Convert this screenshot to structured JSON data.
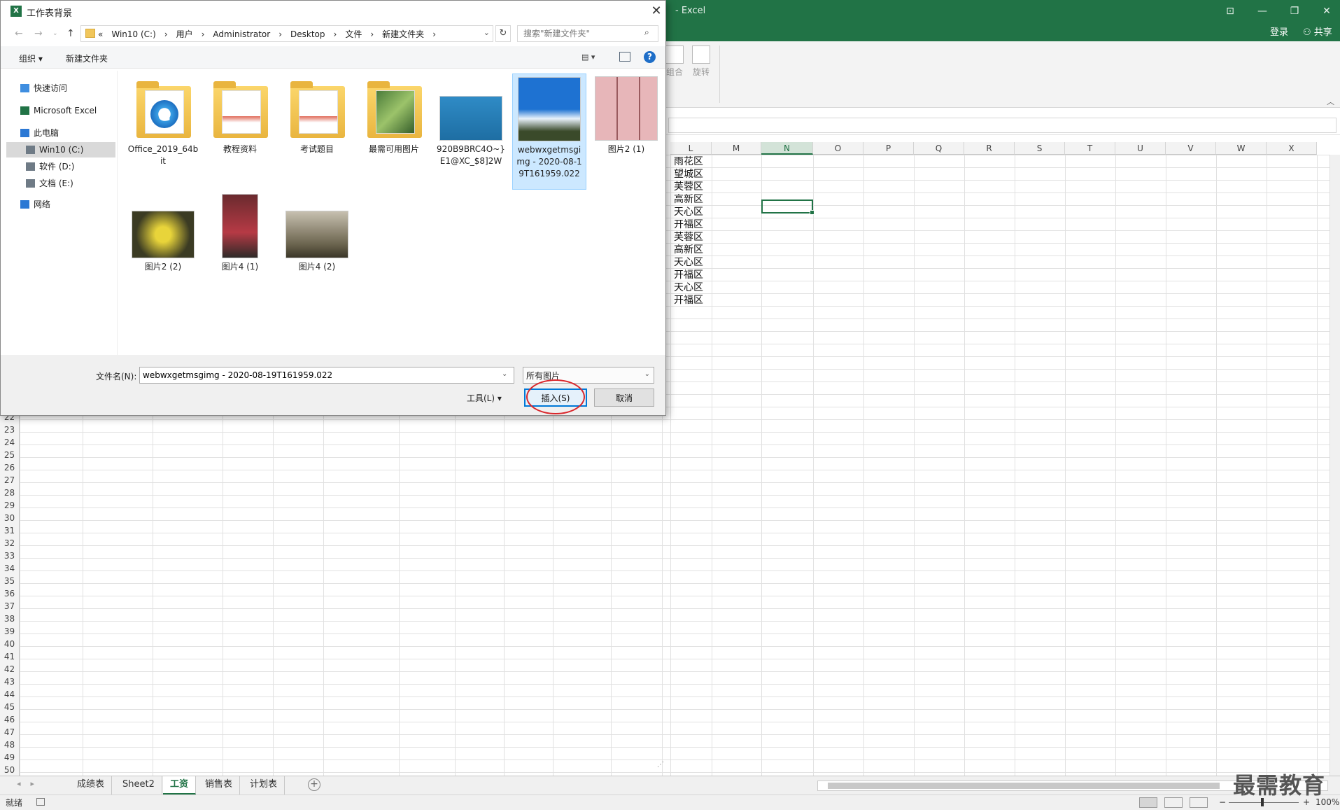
{
  "excel": {
    "title": "- Excel",
    "window_controls": [
      "⊡",
      "—",
      "❐",
      "✕"
    ],
    "login": "登录",
    "share": "共享",
    "ribbon": {
      "combine_label": "组合",
      "rotate_label": "旋转"
    },
    "columns": [
      "L",
      "M",
      "N",
      "O",
      "P",
      "Q",
      "R",
      "S",
      "T",
      "U",
      "V",
      "W",
      "X"
    ],
    "selected_column": "N",
    "column_L_values": [
      "雨花区",
      "望城区",
      "芙蓉区",
      "高新区",
      "天心区",
      "开福区",
      "芙蓉区",
      "高新区",
      "天心区",
      "开福区",
      "天心区",
      "开福区"
    ],
    "row_numbers": [
      "22",
      "23",
      "24",
      "25",
      "26",
      "27",
      "28",
      "29",
      "30",
      "31",
      "32",
      "33",
      "34",
      "35",
      "36",
      "37",
      "38",
      "39",
      "40",
      "41",
      "42",
      "43",
      "44",
      "45",
      "46",
      "47",
      "48",
      "49",
      "50"
    ],
    "sheet_tabs": [
      "成绩表",
      "Sheet2",
      "工资",
      "销售表",
      "计划表"
    ],
    "active_sheet": "工资",
    "status_ready": "就绪",
    "zoom": "100%",
    "watermark": "最需教育"
  },
  "dialog": {
    "title": "工作表背景",
    "breadcrumb": [
      "«",
      "Win10 (C:)",
      "›",
      "用户",
      "›",
      "Administrator",
      "›",
      "Desktop",
      "›",
      "文件",
      "›",
      "新建文件夹",
      "›"
    ],
    "search_placeholder": "搜索\"新建文件夹\"",
    "toolbar": {
      "organize": "组织 ▾",
      "new_folder": "新建文件夹"
    },
    "nav_tree": [
      {
        "label": "快速访问",
        "icon": "star-icon"
      },
      {
        "label": "Microsoft Excel",
        "icon": "excel-icon"
      },
      {
        "label": "此电脑",
        "icon": "computer-icon"
      },
      {
        "label": "Win10 (C:)",
        "icon": "drive-icon",
        "selected": true
      },
      {
        "label": "软件 (D:)",
        "icon": "drive-icon"
      },
      {
        "label": "文档 (E:)",
        "icon": "drive-icon"
      },
      {
        "label": "网络",
        "icon": "network-icon"
      }
    ],
    "files": [
      {
        "name": "Office_2019_64bit",
        "kind": "folder-ie"
      },
      {
        "name": "教程资料",
        "kind": "folder"
      },
      {
        "name": "考试题目",
        "kind": "folder"
      },
      {
        "name": "最需可用图片",
        "kind": "folder-photo"
      },
      {
        "name": "920B9BRC4O~}E1@XC_$8]2W",
        "kind": "image-blue"
      },
      {
        "name": "webwxgetmsgimg - 2020-08-19T161959.022",
        "kind": "image-sky",
        "selected": true
      },
      {
        "name": "图片2 (1)",
        "kind": "image-collage"
      },
      {
        "name": "图片2 (2)",
        "kind": "image-flowers"
      },
      {
        "name": "图片4 (1)",
        "kind": "image-red"
      },
      {
        "name": "图片4 (2)",
        "kind": "image-people"
      }
    ],
    "filename_label": "文件名(N):",
    "filename_value": "webwxgetmsgimg - 2020-08-19T161959.022",
    "filetype_value": "所有图片",
    "tools_label": "工具(L)",
    "insert_label": "插入(S)",
    "cancel_label": "取消",
    "highlight_color": "#d9262b",
    "accent_color": "#217346"
  }
}
